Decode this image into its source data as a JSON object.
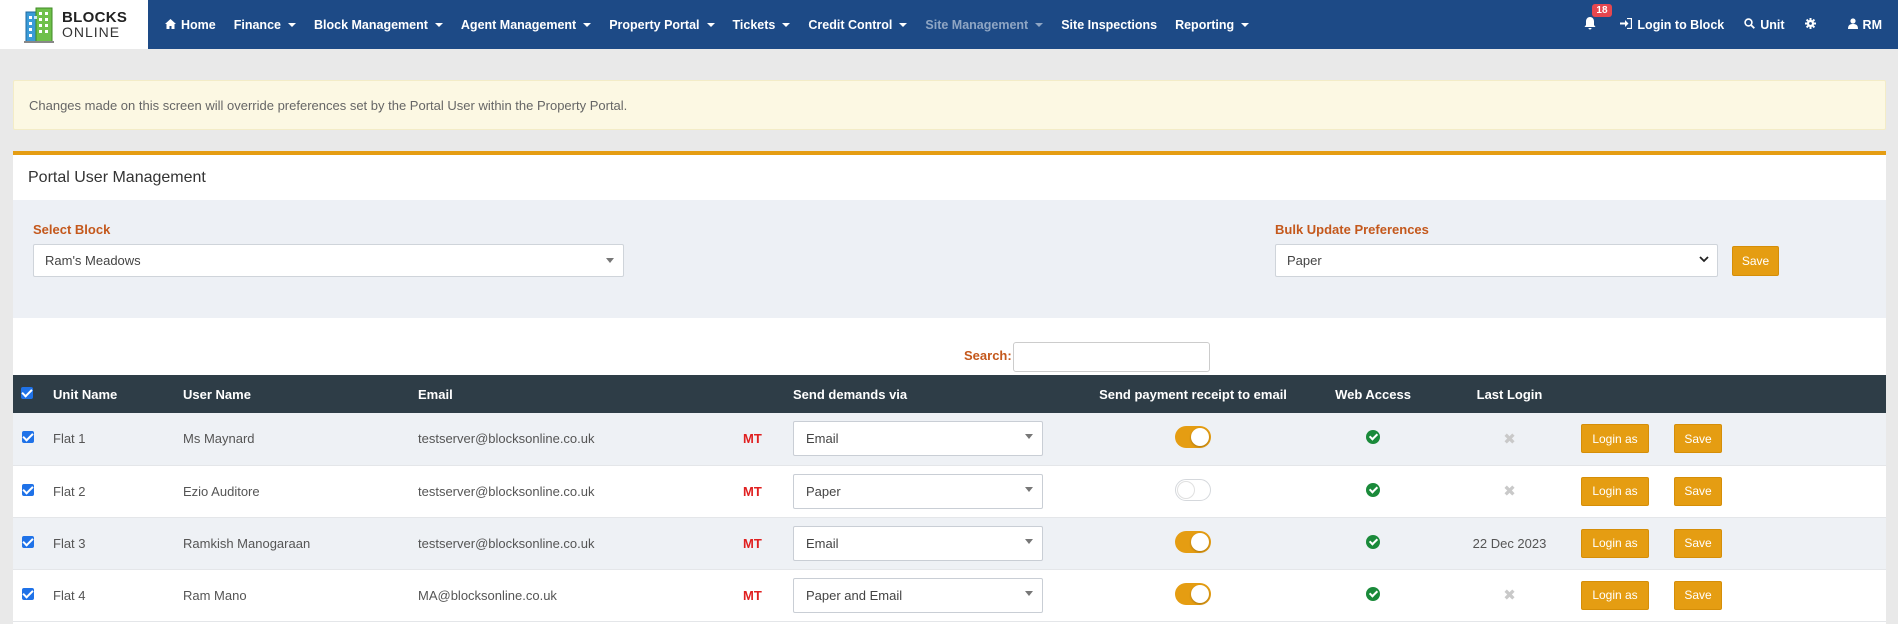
{
  "brand": {
    "line1": "BLOCKS",
    "line2": "ONLINE"
  },
  "nav": {
    "home": "Home",
    "items": [
      {
        "label": "Finance",
        "muted": false
      },
      {
        "label": "Block Management",
        "muted": false
      },
      {
        "label": "Agent Management",
        "muted": false
      },
      {
        "label": "Property Portal",
        "muted": false
      },
      {
        "label": "Tickets",
        "muted": false
      },
      {
        "label": "Credit Control",
        "muted": false
      },
      {
        "label": "Site Management",
        "muted": true
      }
    ],
    "site_inspections": "Site Inspections",
    "reporting": "Reporting",
    "notification_count": "18",
    "login_to_block": "Login to Block",
    "unit": "Unit",
    "user_initials": "RM"
  },
  "alert": {
    "text": "Changes made on this screen will override preferences set by the Portal User within the Property Portal."
  },
  "panel": {
    "title": "Portal User Management"
  },
  "filters": {
    "select_block_label": "Select Block",
    "select_block_value": "Ram's Meadows",
    "bulk_label": "Bulk Update Preferences",
    "bulk_value": "Paper",
    "bulk_save": "Save"
  },
  "search": {
    "label": "Search:",
    "value": ""
  },
  "table": {
    "headers": {
      "unit_name": "Unit Name",
      "user_name": "User Name",
      "email": "Email",
      "send_via": "Send demands via",
      "receipt": "Send payment receipt to email",
      "web_access": "Web Access",
      "last_login": "Last Login"
    },
    "rows": [
      {
        "unit": "Flat 1",
        "user": "Ms Maynard",
        "email": "testserver@blocksonline.co.uk",
        "tag": "MT",
        "send_via": "Email",
        "receipt_on": true,
        "last_login": "",
        "login_as": "Login as",
        "save": "Save"
      },
      {
        "unit": "Flat 2",
        "user": "Ezio Auditore",
        "email": "testserver@blocksonline.co.uk",
        "tag": "MT",
        "send_via": "Paper",
        "receipt_on": false,
        "last_login": "",
        "login_as": "Login as",
        "save": "Save"
      },
      {
        "unit": "Flat 3",
        "user": "Ramkish Manogaraan",
        "email": "testserver@blocksonline.co.uk",
        "tag": "MT",
        "send_via": "Email",
        "receipt_on": true,
        "last_login": "22 Dec 2023",
        "login_as": "Login as",
        "save": "Save"
      },
      {
        "unit": "Flat 4",
        "user": "Ram Mano",
        "email": "MA@blocksonline.co.uk",
        "tag": "MT",
        "send_via": "Paper and Email",
        "receipt_on": true,
        "last_login": "",
        "login_as": "Login as",
        "save": "Save"
      }
    ]
  },
  "colors": {
    "navbar": "#1d4a86",
    "accent": "#e59d12",
    "table_header": "#2e3d47",
    "label": "#c4581c"
  }
}
